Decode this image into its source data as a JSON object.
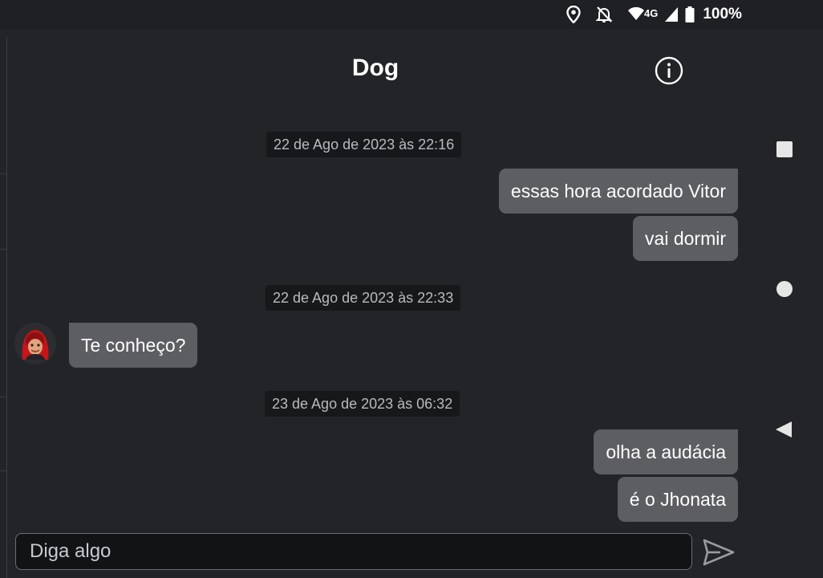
{
  "status_bar": {
    "network": "4G",
    "battery": "100%"
  },
  "header": {
    "title": "Dog",
    "info_icon": "info-circle-icon"
  },
  "messages": {
    "ts1": "22 de Ago de 2023 às 22:16",
    "m1": "essas hora acordado Vitor",
    "m2": "vai dormir",
    "ts2": "22 de Ago de 2023 às 22:33",
    "m3": "Te conheço?",
    "ts3": "23 de Ago de 2023 às 06:32",
    "m4": "olha a audácia",
    "m5": "é o Jhonata"
  },
  "composer": {
    "placeholder": "Diga algo",
    "send_icon": "send-icon"
  },
  "nav": {
    "icons": [
      "recents-square-icon",
      "home-circle-icon",
      "back-triangle-icon"
    ]
  },
  "colors": {
    "background": "#232427",
    "bubble": "#5d5e61",
    "timestamp_bg": "#17181a"
  }
}
